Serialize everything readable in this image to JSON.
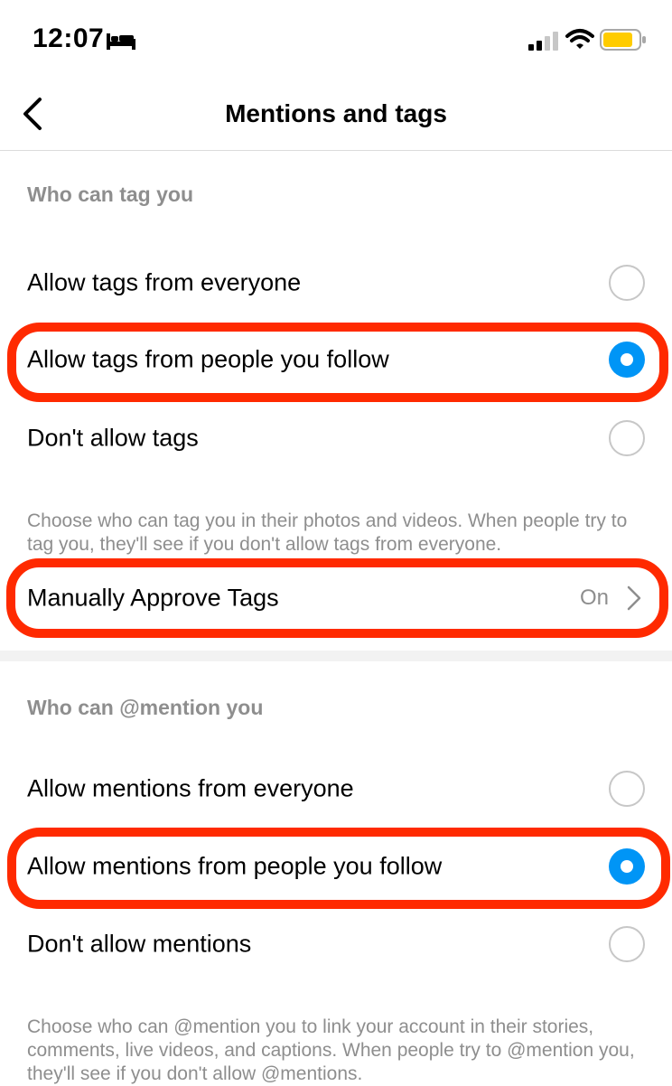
{
  "status_bar": {
    "time": "12:07"
  },
  "nav": {
    "title": "Mentions and tags"
  },
  "tags_section": {
    "header": "Who can tag you",
    "options": [
      {
        "label": "Allow tags from everyone",
        "selected": false
      },
      {
        "label": "Allow tags from people you follow",
        "selected": true
      },
      {
        "label": "Don't allow tags",
        "selected": false
      }
    ],
    "helper": "Choose who can tag you in their photos and videos. When people try to tag you, they'll see if you don't allow tags from everyone.",
    "manual_approve": {
      "label": "Manually Approve Tags",
      "value": "On"
    }
  },
  "mentions_section": {
    "header": "Who can @mention you",
    "options": [
      {
        "label": "Allow mentions from everyone",
        "selected": false
      },
      {
        "label": "Allow mentions from people you follow",
        "selected": true
      },
      {
        "label": "Don't allow mentions",
        "selected": false
      }
    ],
    "helper": "Choose who can @mention you to link your account in their stories, comments, live videos, and captions. When people try to @mention you, they'll see if you don't allow @mentions."
  },
  "colors": {
    "accent": "#0095f6",
    "highlight": "#ff2a00",
    "secondary_text": "#8e8e8e"
  }
}
